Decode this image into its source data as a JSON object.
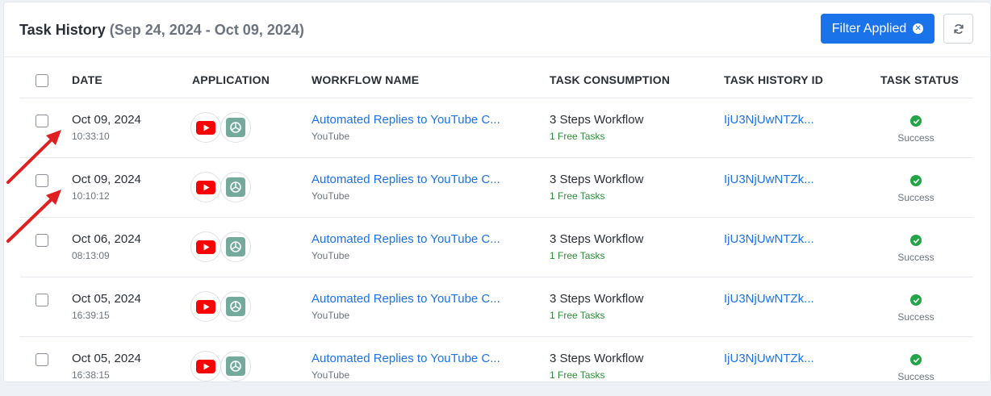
{
  "header": {
    "title": "Task History",
    "date_range": "(Sep 24, 2024 - Oct 09, 2024)",
    "filter_label": "Filter Applied"
  },
  "columns": {
    "date": "DATE",
    "application": "APPLICATION",
    "workflow_name": "WORKFLOW NAME",
    "task_consumption": "TASK CONSUMPTION",
    "task_history_id": "TASK HISTORY ID",
    "task_status": "TASK STATUS"
  },
  "rows": [
    {
      "date": "Oct 09, 2024",
      "time": "10:33:10",
      "workflow": "Automated Replies to YouTube C...",
      "workflow_app": "YouTube",
      "consumption": "3 Steps Workflow",
      "free_tasks": "1 Free Tasks",
      "history_id": "IjU3NjUwNTZk...",
      "status": "Success"
    },
    {
      "date": "Oct 09, 2024",
      "time": "10:10:12",
      "workflow": "Automated Replies to YouTube C...",
      "workflow_app": "YouTube",
      "consumption": "3 Steps Workflow",
      "free_tasks": "1 Free Tasks",
      "history_id": "IjU3NjUwNTZk...",
      "status": "Success"
    },
    {
      "date": "Oct 06, 2024",
      "time": "08:13:09",
      "workflow": "Automated Replies to YouTube C...",
      "workflow_app": "YouTube",
      "consumption": "3 Steps Workflow",
      "free_tasks": "1 Free Tasks",
      "history_id": "IjU3NjUwNTZk...",
      "status": "Success"
    },
    {
      "date": "Oct 05, 2024",
      "time": "16:39:15",
      "workflow": "Automated Replies to YouTube C...",
      "workflow_app": "YouTube",
      "consumption": "3 Steps Workflow",
      "free_tasks": "1 Free Tasks",
      "history_id": "IjU3NjUwNTZk...",
      "status": "Success"
    },
    {
      "date": "Oct 05, 2024",
      "time": "16:38:15",
      "workflow": "Automated Replies to YouTube C...",
      "workflow_app": "YouTube",
      "consumption": "3 Steps Workflow",
      "free_tasks": "1 Free Tasks",
      "history_id": "IjU3NjUwNTZk...",
      "status": "Success"
    }
  ],
  "icons": {
    "app_1": "youtube-icon",
    "app_2": "openai-icon",
    "status": "check-circle-icon",
    "refresh": "refresh-icon",
    "filter_clear": "close-circle-icon"
  },
  "colors": {
    "accent": "#1a73e8",
    "success": "#22a447",
    "free_tasks": "#2e8b3a",
    "youtube": "#ff0000",
    "openai": "#74aa9c",
    "annotation_arrow": "#e02020"
  }
}
